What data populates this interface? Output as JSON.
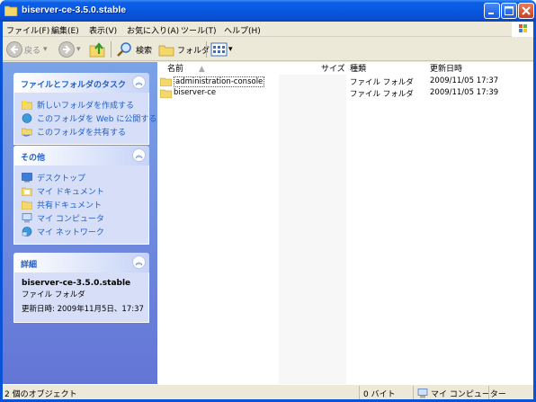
{
  "window": {
    "title": "biserver-ce-3.5.0.stable"
  },
  "menu": {
    "items": [
      "ファイル(F)",
      "編集(E)",
      "表示(V)",
      "お気に入り(A)",
      "ツール(T)",
      "ヘルプ(H)"
    ]
  },
  "toolbar": {
    "back_label": "戻る",
    "search_label": "検索",
    "folders_label": "フォルダ"
  },
  "taskpane": {
    "file_tasks": {
      "title": "ファイルとフォルダのタスク",
      "items": [
        "新しいフォルダを作成する",
        "このフォルダを Web に公開する",
        "このフォルダを共有する"
      ]
    },
    "other_places": {
      "title": "その他",
      "items": [
        "デスクトップ",
        "マイ ドキュメント",
        "共有ドキュメント",
        "マイ コンピュータ",
        "マイ ネットワーク"
      ]
    },
    "details": {
      "title": "詳細",
      "name": "biserver-ce-3.5.0.stable",
      "type": "ファイル フォルダ",
      "modified": "更新日時: 2009年11月5日、17:37"
    }
  },
  "filelist": {
    "columns": {
      "name": "名前",
      "size": "サイズ",
      "type": "種類",
      "date": "更新日時"
    },
    "rows": [
      {
        "name": "administration-console",
        "type": "ファイル フォルダ",
        "date": "2009/11/05 17:37"
      },
      {
        "name": "biserver-ce",
        "type": "ファイル フォルダ",
        "date": "2009/11/05 17:39"
      }
    ]
  },
  "statusbar": {
    "objects": "2 個のオブジェクト",
    "size": "0 バイト",
    "location": "マイ コンピューター"
  },
  "colors": {
    "titlebar": "#0a53d6",
    "task_link": "#215dc6",
    "folder": "#f5d86b"
  }
}
